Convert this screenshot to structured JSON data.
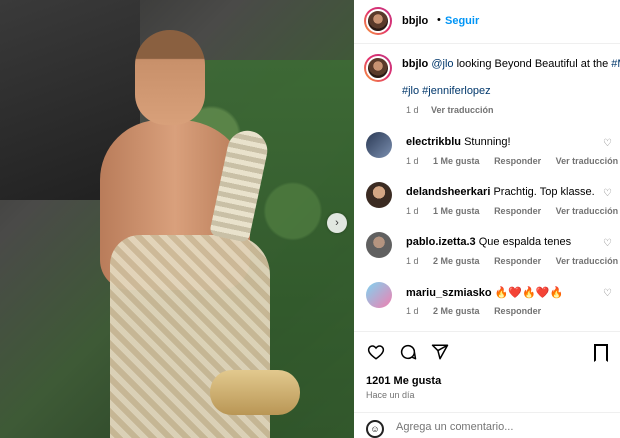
{
  "post": {
    "username": "bbjlo",
    "follow_label": "Seguir",
    "separator": "•",
    "caption": {
      "username": "bbjlo",
      "mention": "@jlo",
      "text": " looking Beyond Beautiful at the ",
      "hashtag_tail": "#M",
      "tags": "#jlo #jenniferlopez",
      "time": "1 d",
      "translate_label": "Ver traducción"
    },
    "comments": [
      {
        "user": "electrikblu",
        "text": "Stunning!",
        "time": "1 d",
        "likes": "1 Me gusta",
        "reply": "Responder",
        "translate": "Ver traducción"
      },
      {
        "user": "delandsheerkari",
        "text": "Prachtig. Top klasse.",
        "time": "1 d",
        "likes": "1 Me gusta",
        "reply": "Responder",
        "translate": "Ver traducción"
      },
      {
        "user": "pablo.izetta.3",
        "text": "Que espalda tenes",
        "time": "1 d",
        "likes": "2 Me gusta",
        "reply": "Responder",
        "translate": "Ver traducción"
      },
      {
        "user": "mariu_szmiasko",
        "text": "🔥❤️🔥❤️🔥",
        "time": "1 d",
        "likes": "2 Me gusta",
        "reply": "Responder",
        "translate": ""
      }
    ],
    "likes": "1201 Me gusta",
    "posted_ago": "Hace un día",
    "comment_placeholder": "Agrega un comentario..."
  },
  "icons": {
    "like": "heart-icon",
    "comment": "comment-icon",
    "share": "share-icon",
    "save": "bookmark-icon",
    "emoji": "emoji-icon",
    "next": "chevron-right-icon"
  },
  "colors": {
    "accent": "#0095f6",
    "link": "#00376b",
    "muted": "#737373"
  }
}
